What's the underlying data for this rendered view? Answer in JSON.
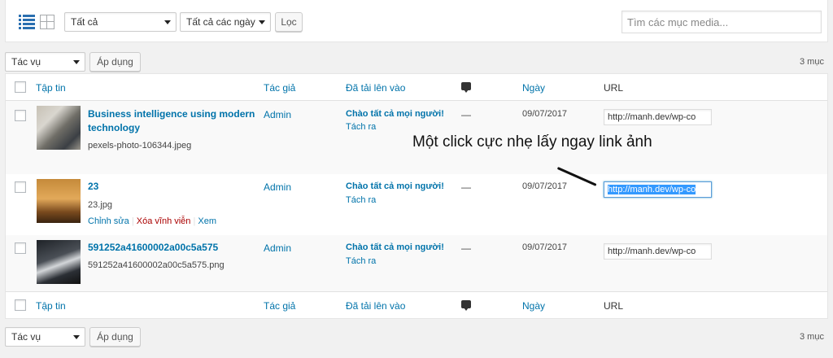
{
  "filters": {
    "type_select": "Tất cả",
    "date_select": "Tất cả các ngày",
    "filter_button": "Lọc",
    "search_placeholder": "Tìm các mục media..."
  },
  "bulk": {
    "action_select": "Tác vụ",
    "apply_button": "Áp dụng",
    "count": "3 mục"
  },
  "columns": {
    "file": "Tập tin",
    "author": "Tác giả",
    "attached": "Đã tải lên vào",
    "date": "Ngày",
    "url": "URL"
  },
  "rows": [
    {
      "title": "Business intelligence using modern technology",
      "filename": "pexels-photo-106344.jpeg",
      "author": "Admin",
      "attached_to": "Chào tất cả mọi người!",
      "detach": "Tách ra",
      "comments": "—",
      "date": "09/07/2017",
      "url": "http://manh.dev/wp-co"
    },
    {
      "title": "23",
      "filename": "23.jpg",
      "author": "Admin",
      "attached_to": "Chào tất cả mọi người!",
      "detach": "Tách ra",
      "comments": "—",
      "date": "09/07/2017",
      "url": "http://manh.dev/wp-co",
      "actions": {
        "edit": "Chỉnh sửa",
        "delete": "Xóa vĩnh viễn",
        "view": "Xem",
        "separator": "|"
      }
    },
    {
      "title": "591252a41600002a00c5a575",
      "filename": "591252a41600002a00c5a575.png",
      "author": "Admin",
      "attached_to": "Chào tất cả mọi người!",
      "detach": "Tách ra",
      "comments": "—",
      "date": "09/07/2017",
      "url": "http://manh.dev/wp-co"
    }
  ],
  "annotation": "Một click cực nhẹ lấy ngay link ảnh",
  "icons": {
    "list_view": "list-view-icon",
    "grid_view": "grid-view-icon",
    "comments": "comment-bubble-icon"
  },
  "colors": {
    "link": "#0073aa",
    "delete": "#aa0000",
    "selection": "#3399ff",
    "active_view": "#2a6fb0"
  }
}
